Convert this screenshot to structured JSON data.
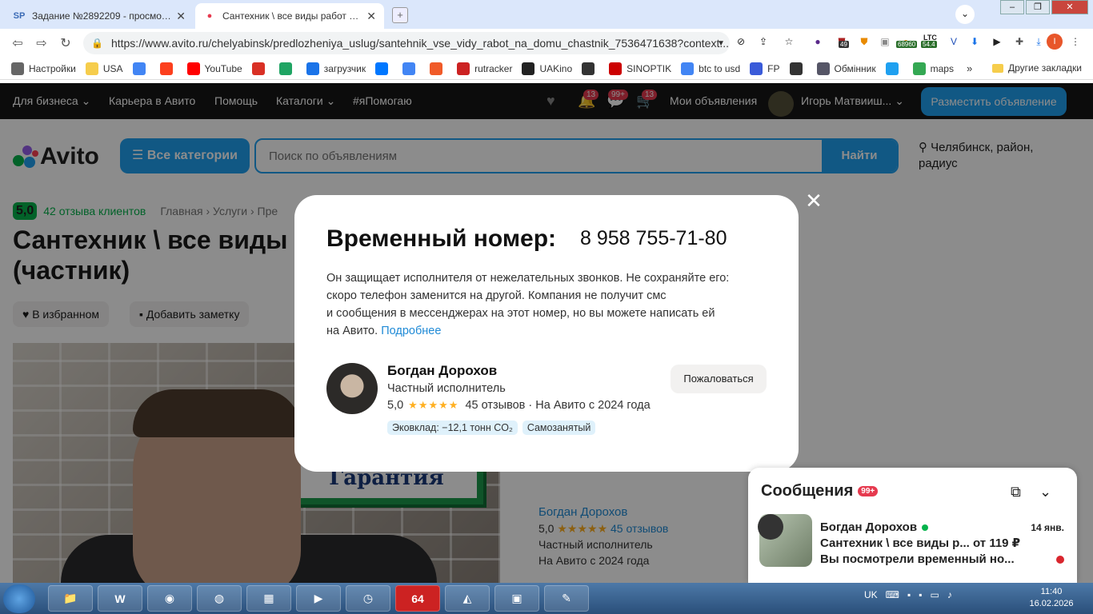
{
  "browser": {
    "tabs": [
      {
        "favicon": "SP",
        "title": "Задание №2892209 - просмотр з",
        "active": false
      },
      {
        "favicon": "●",
        "title": "Сантехник \\ все виды работ на д",
        "active": true
      }
    ],
    "url": "https://www.avito.ru/chelyabinsk/predlozheniya_uslug/santehnik_vse_vidy_rabot_na_domu_chastnik_7536471638?context...",
    "ext_badges": {
      "badge1": "49",
      "badge2": "68960",
      "ltc_label": "LTC",
      "ltc_value": "54.4"
    },
    "profile_initial": "I"
  },
  "bookmarks": {
    "items": [
      {
        "label": "Настройки",
        "icon": "gear-icon",
        "color": "#666"
      },
      {
        "label": "USA",
        "icon": "folder-icon",
        "color": "#f6cd4c"
      },
      {
        "label": "",
        "icon": "google-icon",
        "color": "#4285f4"
      },
      {
        "label": "",
        "icon": "yandex-icon",
        "color": "#fc3f1d"
      },
      {
        "label": "YouTube",
        "icon": "youtube-icon",
        "color": "#ff0000"
      },
      {
        "label": "",
        "icon": "gmail-icon",
        "color": "#d93025"
      },
      {
        "label": "",
        "icon": "drive-icon",
        "color": "#1fa463"
      },
      {
        "label": "загрузчик",
        "icon": "loader-icon",
        "color": "#1a73e8"
      },
      {
        "label": "",
        "icon": "vk-icon",
        "color": "#0077ff"
      },
      {
        "label": "",
        "icon": "translate-icon",
        "color": "#4285f4"
      },
      {
        "label": "",
        "icon": "f-icon",
        "color": "#f05a28"
      },
      {
        "label": "rutracker",
        "icon": "rutracker-icon",
        "color": "#c22"
      },
      {
        "label": "UAKino",
        "icon": "uakino-icon",
        "color": "#222"
      },
      {
        "label": "",
        "icon": "chess-icon",
        "color": "#333"
      },
      {
        "label": "SINOPTIK",
        "icon": "thermometer-icon",
        "color": "#c00"
      },
      {
        "label": "btc to usd",
        "icon": "google-icon",
        "color": "#4285f4"
      },
      {
        "label": "FP",
        "icon": "fp-icon",
        "color": "#3a5bd9"
      },
      {
        "label": "",
        "icon": "bc-icon",
        "color": "#333"
      },
      {
        "label": "Обмінник",
        "icon": "exchange-icon",
        "color": "#556"
      },
      {
        "label": "",
        "icon": "star-icon",
        "color": "#1fa0f0"
      },
      {
        "label": "maps",
        "icon": "maps-icon",
        "color": "#34a853"
      }
    ],
    "more": "»",
    "other": "Другие закладки"
  },
  "avito_nav": {
    "business": "Для бизнеса",
    "career": "Карьера в Авито",
    "help": "Помощь",
    "catalogs": "Каталоги",
    "hashtag": "#яПомогаю",
    "notif_badge": "13",
    "msg_badge": "99+",
    "cart_badge": "13",
    "my_ads": "Мои объявления",
    "user": "Игорь Матвииш...",
    "post_ad": "Разместить объявление"
  },
  "header": {
    "logo": "Avito",
    "categories_btn": "Все категории",
    "search_placeholder": "Поиск по объявлениям",
    "find_btn": "Найти",
    "location": "Челябинск, район, радиус"
  },
  "listing": {
    "rating": "5,0",
    "reviews": "42 отзыва клиентов",
    "breadcrumbs": "Главная › Услуги › Пре",
    "title": "Сантехник \\ все виды (частник)",
    "fav_btn": "В избранном",
    "note_btn": "Добавить заметку",
    "photo_sign": "Гарантия",
    "seller_name": "Богдан Дорохов",
    "seller_rating": "5,0",
    "seller_reviews": "45 отзывов",
    "seller_role": "Частный исполнитель",
    "seller_since": "На Авито с 2024 года"
  },
  "modal": {
    "title": "Временный номер:",
    "phone": "8 958 755-71-80",
    "desc_line1": "Он защищает исполнителя от нежелательных звонков. Не сохраняйте его:",
    "desc_line2": "скоро телефон заменится на другой. Компания не получит смс",
    "desc_line3": "и сообщения в мессенджерах на этот номер, но вы можете написать ей",
    "desc_line4": "на Авито.",
    "more_link": "Подробнее",
    "name": "Богдан Дорохов",
    "role": "Частный исполнитель",
    "rating": "5,0",
    "stars": "★★★★★",
    "reviews": "45 отзывов",
    "since": "· На Авито с 2024 года",
    "tag_eco": "Эковклад: −12,1 тонн CO₂",
    "tag_self": "Самозанятый",
    "complain": "Пожаловаться"
  },
  "messages": {
    "title": "Сообщения",
    "badge": "99+",
    "name": "Богдан Дорохов",
    "date": "14 янв.",
    "subject": "Сантехник \\ все виды р... от 119 ₽",
    "preview": "Вы посмотрели временный но..."
  },
  "taskbar": {
    "lang": "UK",
    "time": "11:40",
    "date": "16.02.2026",
    "app_64": "64"
  }
}
